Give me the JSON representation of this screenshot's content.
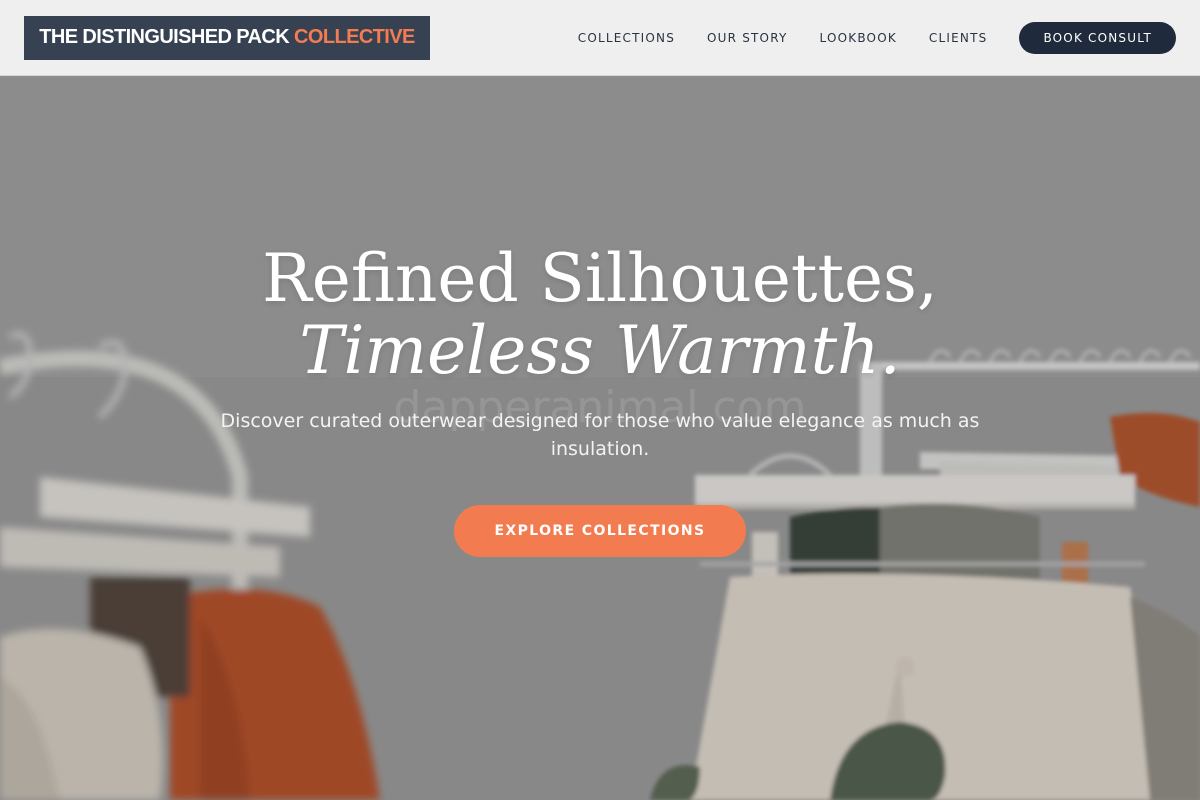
{
  "header": {
    "logo_main": "THE DISTINGUISHED PACK",
    "logo_accent": "COLLECTIVE",
    "nav": [
      {
        "label": "COLLECTIONS"
      },
      {
        "label": "OUR STORY"
      },
      {
        "label": "LOOKBOOK"
      },
      {
        "label": "CLIENTS"
      }
    ],
    "cta_label": "BOOK CONSULT"
  },
  "hero": {
    "headline_line1": "Refined Silhouettes,",
    "headline_line2": "Timeless Warmth.",
    "subtext": "Discover curated outerwear designed for those who value elegance as much as insulation.",
    "cta_label": "EXPLORE COLLECTIONS",
    "watermark": "dapperanimal.com"
  },
  "colors": {
    "accent": "#f27c4f",
    "navy": "#1f2a3d",
    "logo_bg": "#364152",
    "header_bg": "#efefef"
  }
}
